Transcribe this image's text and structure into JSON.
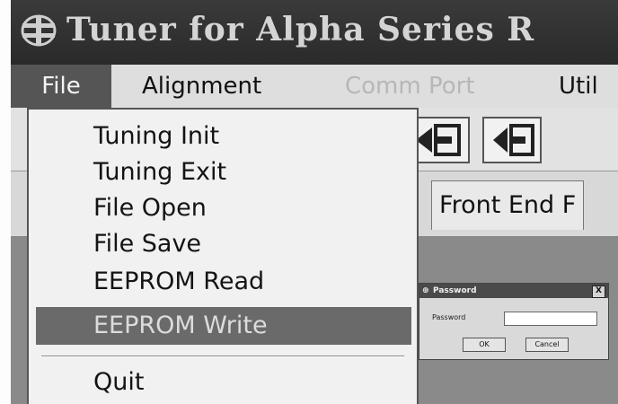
{
  "window": {
    "title": "Tuner for Alpha Series R",
    "icon": "app-emblem-icon"
  },
  "menubar": {
    "items": [
      {
        "label": "File",
        "state": "open"
      },
      {
        "label": "Alignment",
        "state": "normal"
      },
      {
        "label": "Comm Port",
        "state": "disabled"
      },
      {
        "label": "Util",
        "state": "normal"
      }
    ]
  },
  "file_menu": {
    "items": [
      {
        "label": "Tuning Init"
      },
      {
        "label": "Tuning Exit"
      },
      {
        "label": "File Open"
      },
      {
        "label": "File Save"
      },
      {
        "label": "EEPROM Read"
      },
      {
        "label": "EEPROM Write",
        "highlighted": true
      },
      {
        "label": "Quit"
      }
    ]
  },
  "toolbar": {
    "buttons": [
      {
        "icon": "arrow-right-into-box-icon"
      },
      {
        "icon": "arrow-left-into-box-icon"
      }
    ]
  },
  "tabs": {
    "front_end": "Front End F"
  },
  "password_dialog": {
    "title": "Password",
    "close_label": "X",
    "field_label": "Password",
    "field_value": "",
    "ok_label": "OK",
    "cancel_label": "Cancel"
  },
  "colors": {
    "title_bar": "#2e2e2e",
    "menu_highlight": "#555555",
    "selected_item": "#6a6a6a",
    "work_area": "#8a8a8a"
  }
}
